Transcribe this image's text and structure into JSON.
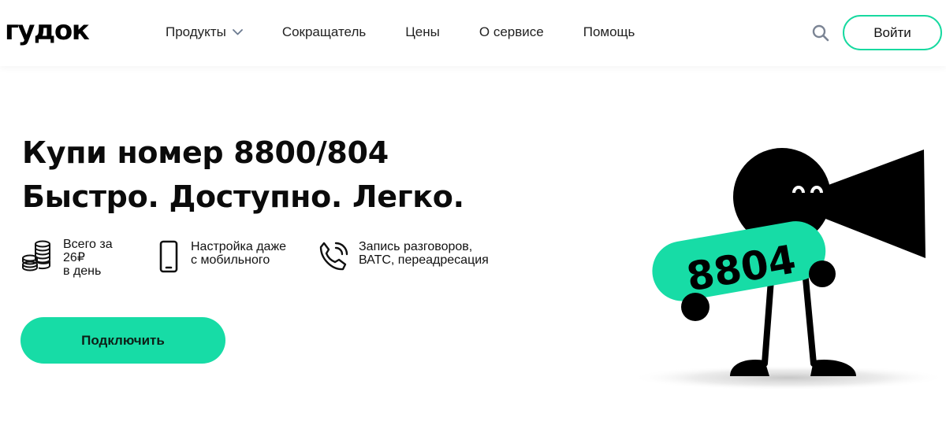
{
  "header": {
    "logo": "гудок",
    "nav": [
      {
        "label": "Продукты",
        "has_dropdown": true
      },
      {
        "label": "Сокращатель"
      },
      {
        "label": "Цены"
      },
      {
        "label": "О сервисе"
      },
      {
        "label": "Помощь"
      }
    ],
    "search_icon": "search-icon",
    "login_label": "Войти"
  },
  "hero": {
    "title_line1": "Купи номер 8800/804",
    "title_line2": "Быстро. Доступно. Легко.",
    "features": [
      {
        "icon": "coins-icon",
        "text": "Всего за\n26₽\nв день"
      },
      {
        "icon": "smartphone-icon",
        "text": "Настройка даже\nс мобильного"
      },
      {
        "icon": "phone-call-icon",
        "text": "Запись разговоров,\nВАТС, переадресация"
      }
    ],
    "cta_label": "Подключить"
  },
  "mascot": {
    "badge_text": "8804",
    "icon": "horn-mascot-illustration"
  },
  "colors": {
    "accent": "#17dca6",
    "text": "#111111",
    "background": "#ffffff",
    "icon_gray": "#7b8494"
  }
}
